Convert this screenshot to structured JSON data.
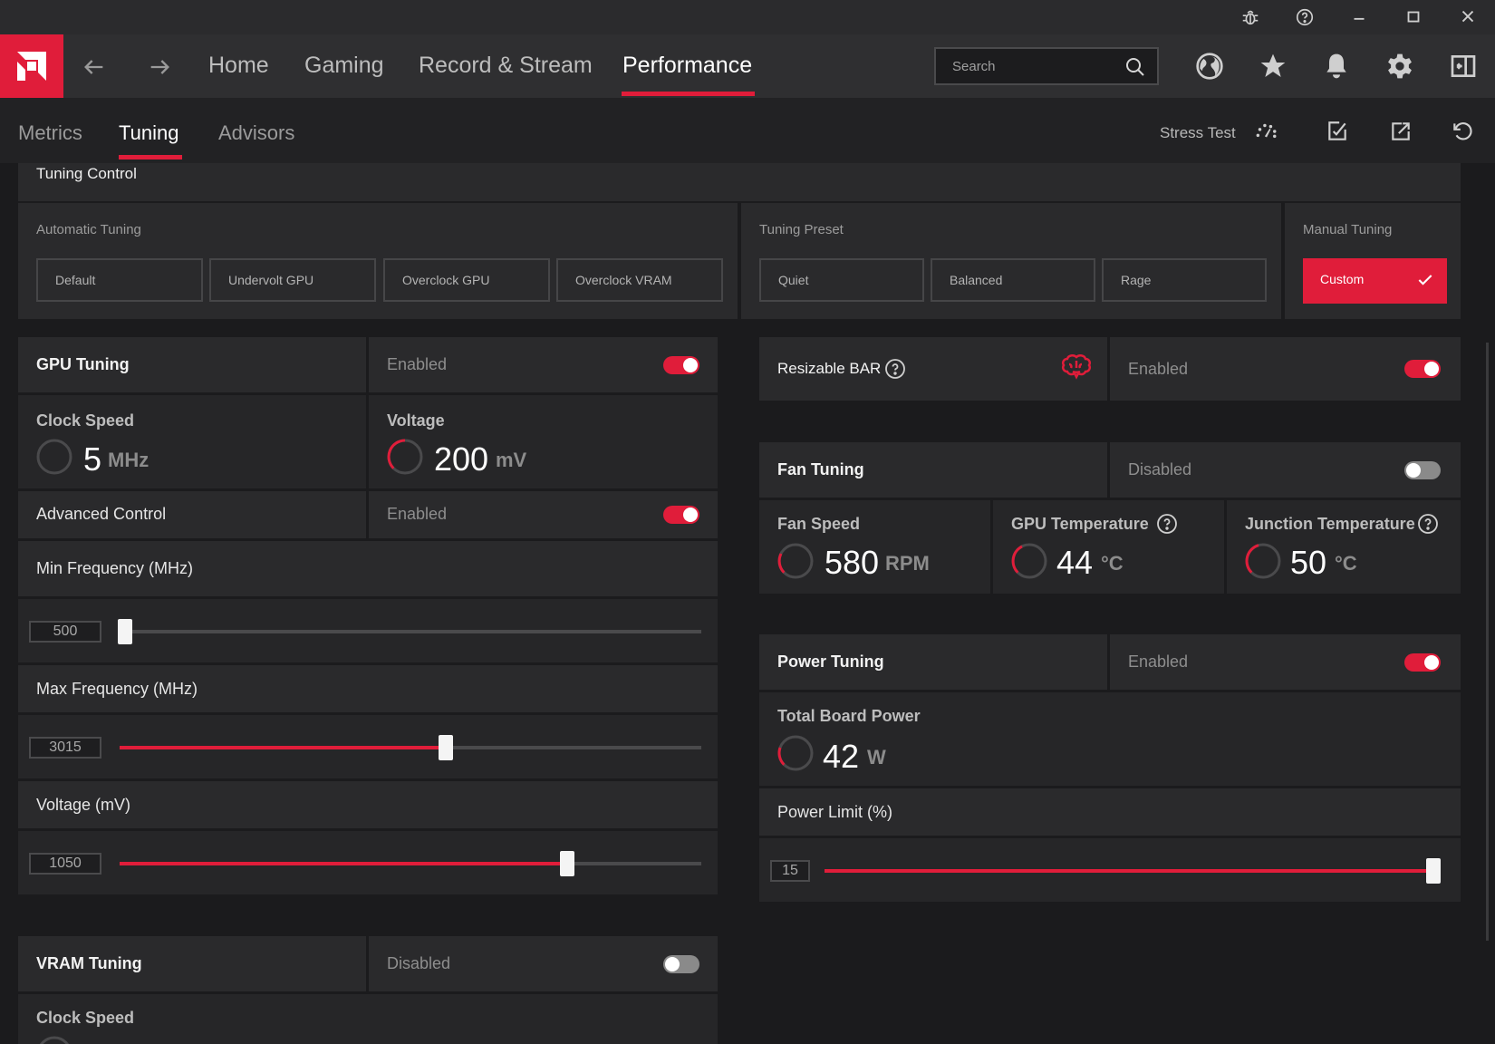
{
  "titlebar": {
    "icons": [
      "bug-icon",
      "help-icon",
      "minimize-icon",
      "maximize-icon",
      "close-icon"
    ]
  },
  "nav": {
    "tabs": [
      {
        "label": "Home"
      },
      {
        "label": "Gaming"
      },
      {
        "label": "Record & Stream"
      },
      {
        "label": "Performance"
      }
    ],
    "active_tab": "Performance",
    "search_placeholder": "Search",
    "icons": [
      "globe-icon",
      "star-icon",
      "bell-icon",
      "gear-icon",
      "sidebar-icon"
    ]
  },
  "subnav": {
    "tabs": [
      {
        "label": "Metrics"
      },
      {
        "label": "Tuning"
      },
      {
        "label": "Advisors"
      }
    ],
    "active_tab": "Tuning",
    "stress_test_label": "Stress Test",
    "icons": [
      "gauge-icon",
      "apply-icon",
      "export-icon",
      "reset-icon"
    ]
  },
  "tuning_control": {
    "title": "Tuning Control",
    "automatic": {
      "label": "Automatic Tuning",
      "buttons": [
        "Default",
        "Undervolt GPU",
        "Overclock GPU",
        "Overclock VRAM"
      ]
    },
    "preset": {
      "label": "Tuning Preset",
      "buttons": [
        "Quiet",
        "Balanced",
        "Rage"
      ]
    },
    "manual": {
      "label": "Manual Tuning",
      "button": "Custom",
      "selected": true
    }
  },
  "gpu_tuning": {
    "title": "GPU Tuning",
    "status": "Enabled",
    "enabled": true,
    "clock": {
      "title": "Clock Speed",
      "value": "5",
      "unit": "MHz"
    },
    "voltage": {
      "title": "Voltage",
      "value": "200",
      "unit": "mV"
    },
    "advanced": {
      "title": "Advanced Control",
      "status": "Enabled",
      "enabled": true
    },
    "min_freq": {
      "title": "Min Frequency (MHz)",
      "value": "500",
      "fraction": 0.0
    },
    "max_freq": {
      "title": "Max Frequency (MHz)",
      "value": "3015",
      "fraction": 0.56
    },
    "voltage_slider": {
      "title": "Voltage (mV)",
      "value": "1050",
      "fraction": 0.77
    }
  },
  "vram_tuning": {
    "title": "VRAM Tuning",
    "status": "Disabled",
    "enabled": false,
    "clock": {
      "title": "Clock Speed"
    }
  },
  "resizable_bar": {
    "title": "Resizable BAR",
    "status": "Enabled",
    "enabled": true,
    "icon": "brain-icon"
  },
  "fan_tuning": {
    "title": "Fan Tuning",
    "status": "Disabled",
    "enabled": false,
    "fan_speed": {
      "title": "Fan Speed",
      "value": "580",
      "unit": "RPM"
    },
    "gpu_temp": {
      "title": "GPU Temperature",
      "value": "44",
      "unit": "°C"
    },
    "junction_temp": {
      "title": "Junction Temperature",
      "value": "50",
      "unit": "°C"
    }
  },
  "power_tuning": {
    "title": "Power Tuning",
    "status": "Enabled",
    "enabled": true,
    "board_power": {
      "title": "Total Board Power",
      "value": "42",
      "unit": "W"
    },
    "power_limit": {
      "title": "Power Limit (%)",
      "value": "15",
      "fraction": 1.0
    }
  },
  "colors": {
    "accent": "#e01d3a",
    "background": "#1b1b1d",
    "panel": "#2a2a2c"
  }
}
